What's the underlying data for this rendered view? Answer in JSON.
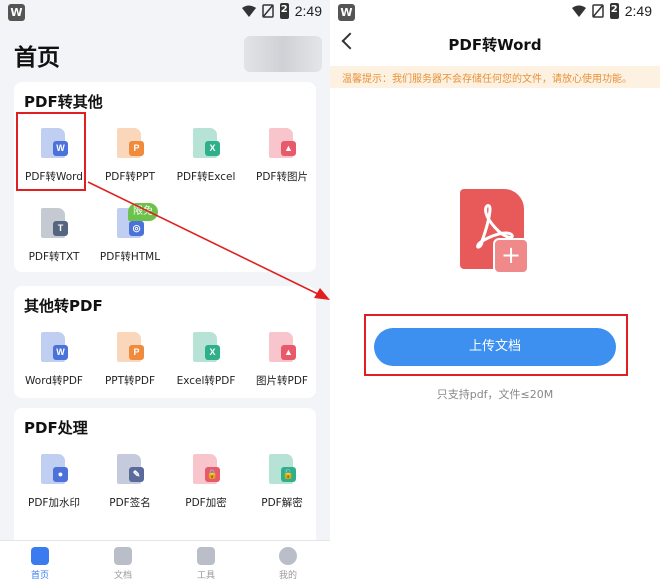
{
  "status": {
    "time": "2:49",
    "battery": "2"
  },
  "left": {
    "title": "首页",
    "sections": [
      {
        "title": "PDF转其他",
        "tools": [
          {
            "label": "PDF转Word",
            "badge": "W",
            "color": "#4a72d9"
          },
          {
            "label": "PDF转PPT",
            "badge": "P",
            "color": "#f08a3c"
          },
          {
            "label": "PDF转Excel",
            "badge": "X",
            "color": "#2fb08a"
          },
          {
            "label": "PDF转图片",
            "badge": "▲",
            "color": "#e85a6a"
          },
          {
            "label": "PDF转TXT",
            "badge": "T",
            "color": "#55657f"
          },
          {
            "label": "PDF转HTML",
            "badge": "◎",
            "color": "#4a72d9"
          }
        ],
        "limited_badge": "限免"
      },
      {
        "title": "其他转PDF",
        "tools": [
          {
            "label": "Word转PDF",
            "badge": "W",
            "color": "#4a72d9"
          },
          {
            "label": "PPT转PDF",
            "badge": "P",
            "color": "#f08a3c"
          },
          {
            "label": "Excel转PDF",
            "badge": "X",
            "color": "#2fb08a"
          },
          {
            "label": "图片转PDF",
            "badge": "▲",
            "color": "#e85a6a"
          }
        ]
      },
      {
        "title": "PDF处理",
        "tools": [
          {
            "label": "PDF加水印",
            "badge": "●",
            "color": "#4a72d9"
          },
          {
            "label": "PDF签名",
            "badge": "✎",
            "color": "#5a6a9a"
          },
          {
            "label": "PDF加密",
            "badge": "🔒",
            "color": "#e85a6a"
          },
          {
            "label": "PDF解密",
            "badge": "🔓",
            "color": "#2fb08a"
          }
        ]
      }
    ],
    "nav": [
      {
        "label": "首页",
        "icon": "home-icon",
        "active": true
      },
      {
        "label": "文档",
        "icon": "folder-icon",
        "active": false
      },
      {
        "label": "工具",
        "icon": "cube-icon",
        "active": false
      },
      {
        "label": "我的",
        "icon": "person-icon",
        "active": false
      }
    ]
  },
  "right": {
    "title": "PDF转Word",
    "tip": "温馨提示：我们服务器不会存储任何您的文件，请放心使用功能。",
    "upload_label": "上传文档",
    "support_text": "只支持pdf，文件≤20M"
  },
  "colors": {
    "accent": "#3d8ff0",
    "highlight": "#e02020",
    "tip": "#e6913b"
  }
}
